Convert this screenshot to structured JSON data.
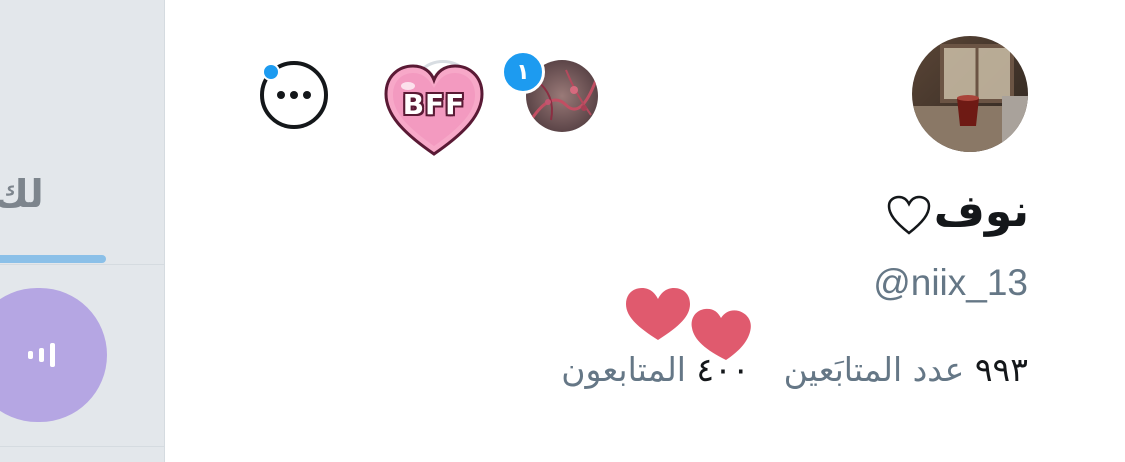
{
  "sidebar": {
    "tab_label": "لك",
    "voice_button_icon": "voice-wave-icon",
    "underline_color": "#8bc0e8",
    "button_color": "#b5a6e3"
  },
  "top_row": {
    "more_icon": "ellipsis-icon",
    "bff_label": "BFF",
    "notification_count": "١",
    "accent_color": "#1d9bf0"
  },
  "profile": {
    "display_name": "نوف",
    "name_symbol": "heart-outline-icon",
    "handle": "@niix_13",
    "following_count": "٩٩٣",
    "following_label": "عدد المتابَعين",
    "followers_count": "٤٠٠",
    "followers_label": "المتابعون"
  },
  "colors": {
    "text_primary": "#14171a",
    "text_secondary": "#657786",
    "sticker_heart": "#e05a6e",
    "bff_heart": "#f7a8c8"
  }
}
